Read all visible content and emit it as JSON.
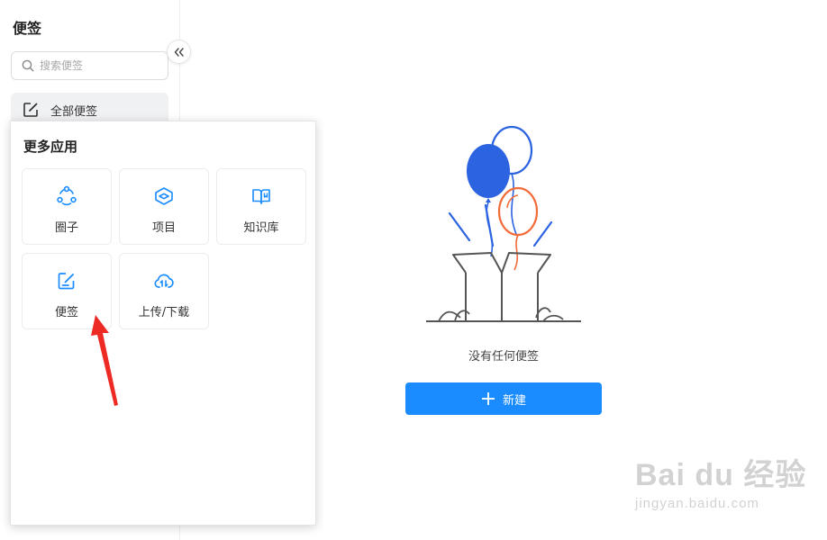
{
  "sidebar": {
    "title": "便签",
    "search_placeholder": "搜索便签",
    "all_notes_label": "全部便签",
    "collapse_icon": "chevron-double-left-icon"
  },
  "popup": {
    "title": "更多应用",
    "apps": [
      {
        "label": "圈子",
        "icon": "circle-group-icon"
      },
      {
        "label": "项目",
        "icon": "project-layers-icon"
      },
      {
        "label": "知识库",
        "icon": "book-icon"
      },
      {
        "label": "便签",
        "icon": "note-edit-icon"
      },
      {
        "label": "上传/下载",
        "icon": "cloud-transfer-icon"
      }
    ]
  },
  "main": {
    "empty_text": "没有任何便签",
    "new_button_label": "新建"
  },
  "watermark": {
    "logo_text": "Bai du 经验",
    "url": "jingyan.baidu.com"
  },
  "colors": {
    "accent": "#1a8cff",
    "icon_blue": "#1a8cff",
    "balloon_blue": "#2c63e0",
    "balloon_orange": "#f26b3a",
    "annotation_red": "#ee2a24"
  }
}
